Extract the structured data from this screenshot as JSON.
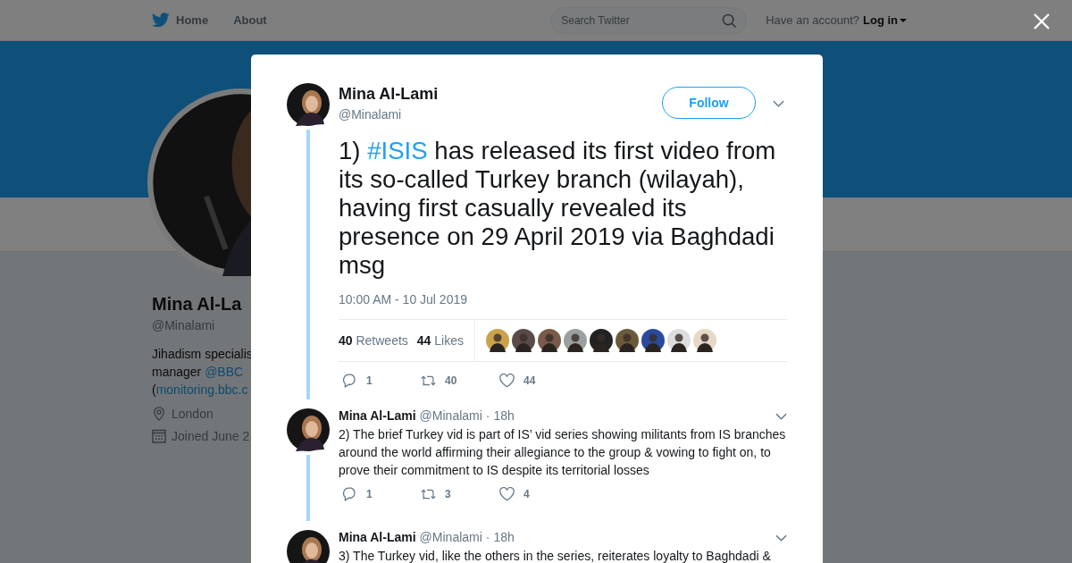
{
  "nav": {
    "links": [
      "Home",
      "About"
    ],
    "search": {
      "placeholder": "Search Twitter"
    },
    "account_prompt": "Have an account?",
    "login": "Log in"
  },
  "profile": {
    "name": "Mina Al-La",
    "handle": "@Minalami",
    "bio_lines": [
      [
        {
          "kind": "text",
          "text": "Jihadism specialis"
        }
      ],
      [
        {
          "kind": "text",
          "text": "manager "
        },
        {
          "kind": "link",
          "text": "@BBC"
        }
      ],
      [
        {
          "kind": "text",
          "text": "("
        },
        {
          "kind": "link",
          "text": "monitoring.bbc.c"
        }
      ]
    ],
    "location": "London",
    "joined": "Joined June 2"
  },
  "tweet": {
    "name": "Mina Al-Lami",
    "handle": "@Minalami",
    "follow": "Follow",
    "text": [
      {
        "kind": "text",
        "text": "1) "
      },
      {
        "kind": "hashtag",
        "text": "#ISIS"
      },
      {
        "kind": "text",
        "text": " has released its first video from its so-called Turkey branch (wilayah), having first casually revealed its presence on 29 April 2019 via Baghdadi msg"
      }
    ],
    "time": "10:00 AM - 10 Jul 2019",
    "stats": [
      {
        "count": "40",
        "label": "Retweets"
      },
      {
        "count": "44",
        "label": "Likes"
      }
    ],
    "actions": [
      {
        "kind": "reply",
        "count": "1"
      },
      {
        "kind": "retweet",
        "count": "40"
      },
      {
        "kind": "like",
        "count": "44"
      }
    ]
  },
  "replies": [
    {
      "name": "Mina Al-Lami",
      "handle": "@Minalami",
      "time": "· 18h",
      "text": "2) The brief Turkey vid is part of IS’ vid series showing militants from IS branches around the world affirming their allegiance to the group & vowing to fight on, to prove their commitment to IS despite its territorial losses",
      "actions": [
        {
          "kind": "reply",
          "count": "1"
        },
        {
          "kind": "retweet",
          "count": "3"
        },
        {
          "kind": "like",
          "count": "4"
        }
      ]
    },
    {
      "name": "Mina Al-Lami",
      "handle": "@Minalami",
      "time": "· 18h",
      "text": "3) The Turkey vid, like the others in the series, reiterates loyalty to Baghdadi &"
    }
  ]
}
